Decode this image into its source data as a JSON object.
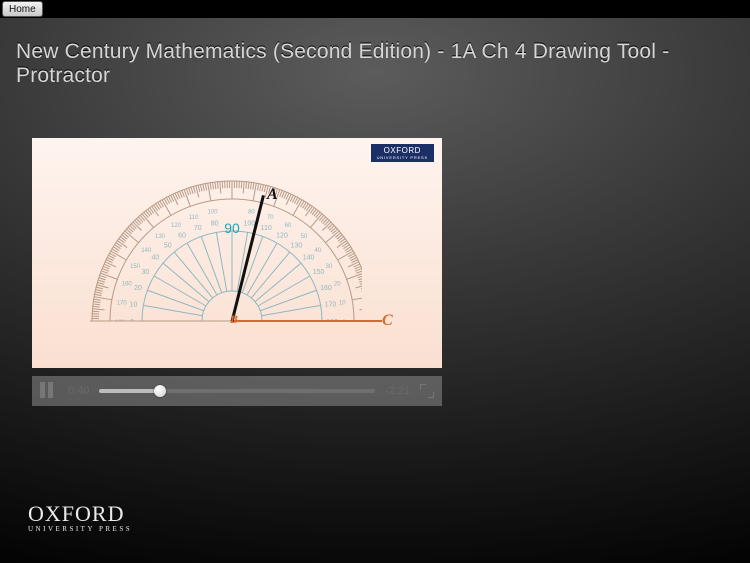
{
  "topbar": {
    "home": "Home"
  },
  "page": {
    "title": "New Century Mathematics (Second Edition) - 1A Ch 4 Drawing Tool - Protractor"
  },
  "video": {
    "badge": {
      "line1": "OXFORD",
      "line2": "UNIVERSITY PRESS"
    },
    "points": {
      "A": "A",
      "B": "B",
      "C": "C"
    },
    "protractor": {
      "center_label": "90"
    }
  },
  "player": {
    "state": "playing",
    "elapsed": "0:40",
    "remaining": "-2:21",
    "progress_pct": 22
  },
  "footer": {
    "brand": "OXFORD",
    "sub": "UNIVERSITY PRESS"
  }
}
